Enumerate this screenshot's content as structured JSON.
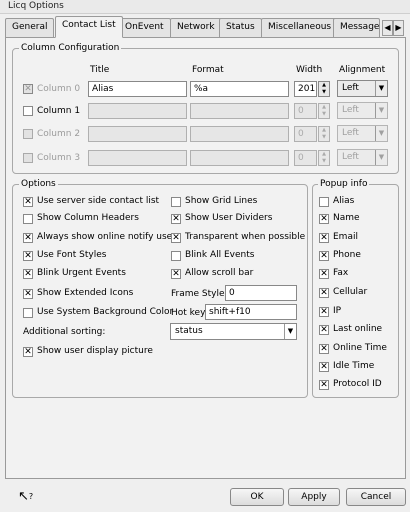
{
  "window": {
    "title": "Licq Options"
  },
  "tabs": [
    "General",
    "Contact List",
    "OnEvent",
    "Network",
    "Status",
    "Miscellaneous",
    "Message"
  ],
  "column_config": {
    "title": "Column Configuration",
    "headers": {
      "title": "Title",
      "format": "Format",
      "width": "Width",
      "alignment": "Alignment"
    },
    "rows": [
      {
        "label": "Column 0",
        "title": "Alias",
        "format": "%a",
        "width": "201",
        "align": "Left"
      },
      {
        "label": "Column 1",
        "title": "",
        "format": "",
        "width": "0",
        "align": "Left"
      },
      {
        "label": "Column 2",
        "title": "",
        "format": "",
        "width": "0",
        "align": "Left"
      },
      {
        "label": "Column 3",
        "title": "",
        "format": "",
        "width": "0",
        "align": "Left"
      }
    ]
  },
  "options": {
    "title": "Options",
    "left": [
      "Use server side contact list",
      "Show Column Headers",
      "Always show online notify users",
      "Use Font Styles",
      "Blink Urgent Events",
      "Show Extended Icons",
      "Use System Background Color"
    ],
    "right": [
      "Show Grid Lines",
      "Show User Dividers",
      "Transparent when possible",
      "Blink All Events",
      "Allow scroll bar"
    ],
    "frame_style_label": "Frame Style:",
    "frame_style_value": "0",
    "hotkey_label": "Hot key:",
    "hotkey_value": "shift+f10",
    "sorting_label": "Additional sorting:",
    "sorting_value": "status",
    "show_picture": "Show user display picture"
  },
  "popup": {
    "title": "Popup info",
    "items": [
      "Alias",
      "Name",
      "Email",
      "Phone",
      "Fax",
      "Cellular",
      "IP",
      "Last online",
      "Online Time",
      "Idle Time",
      "Protocol ID"
    ]
  },
  "buttons": {
    "ok": "OK",
    "apply": "Apply",
    "cancel": "Cancel"
  }
}
